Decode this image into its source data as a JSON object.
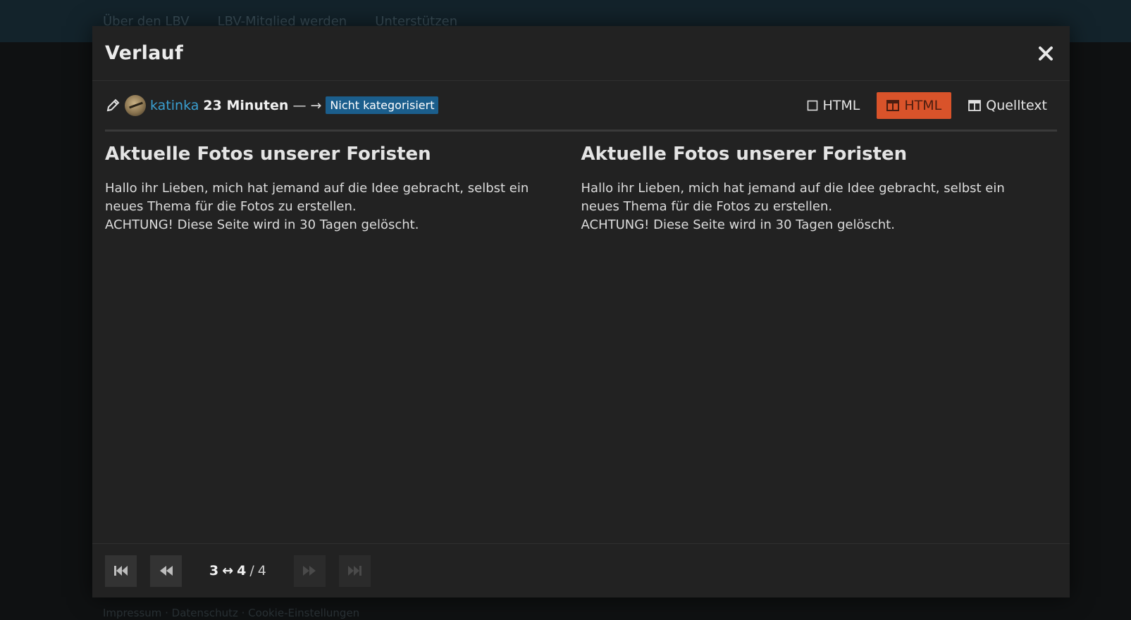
{
  "background": {
    "nav_items": [
      "Über den LBV",
      "LBV-Mitglied werden",
      "Unterstützen"
    ],
    "footer_text": "Impressum · Datenschutz · Cookie-Einstellungen"
  },
  "modal": {
    "title": "Verlauf",
    "close_icon": "close-icon"
  },
  "revision": {
    "edit_icon": "pencil-icon",
    "user": "katinka",
    "time": "23 Minuten",
    "separator": "— →",
    "category": "Nicht kategorisiert"
  },
  "view_toggles": [
    {
      "icon": "square-icon",
      "label": "HTML",
      "active": false
    },
    {
      "icon": "split-view-icon",
      "label": "HTML",
      "active": true
    },
    {
      "icon": "split-view-icon",
      "label": "Quelltext",
      "active": false
    }
  ],
  "left_column": {
    "heading": "Aktuelle Fotos unserer Foristen",
    "line1": "Hallo ihr Lieben, mich hat jemand auf die Idee gebracht, selbst ein neues Thema für die Fotos zu erstellen.",
    "line2": "ACHTUNG! Diese Seite wird in 30 Tagen gelöscht."
  },
  "right_column": {
    "heading": "Aktuelle Fotos unserer Foristen",
    "line1": "Hallo ihr Lieben, mich hat jemand auf die Idee gebracht, selbst ein neues Thema für die Fotos zu erstellen.",
    "line2": "ACHTUNG! Diese Seite wird in 30 Tagen gelöscht."
  },
  "pagination": {
    "from": "3",
    "arrow": "↔",
    "to": "4",
    "slash": "/",
    "total": "4"
  },
  "colors": {
    "accent": "#d9532a",
    "link": "#3a9fd0",
    "badge": "#1b5e8c",
    "modal_bg": "#222222"
  }
}
